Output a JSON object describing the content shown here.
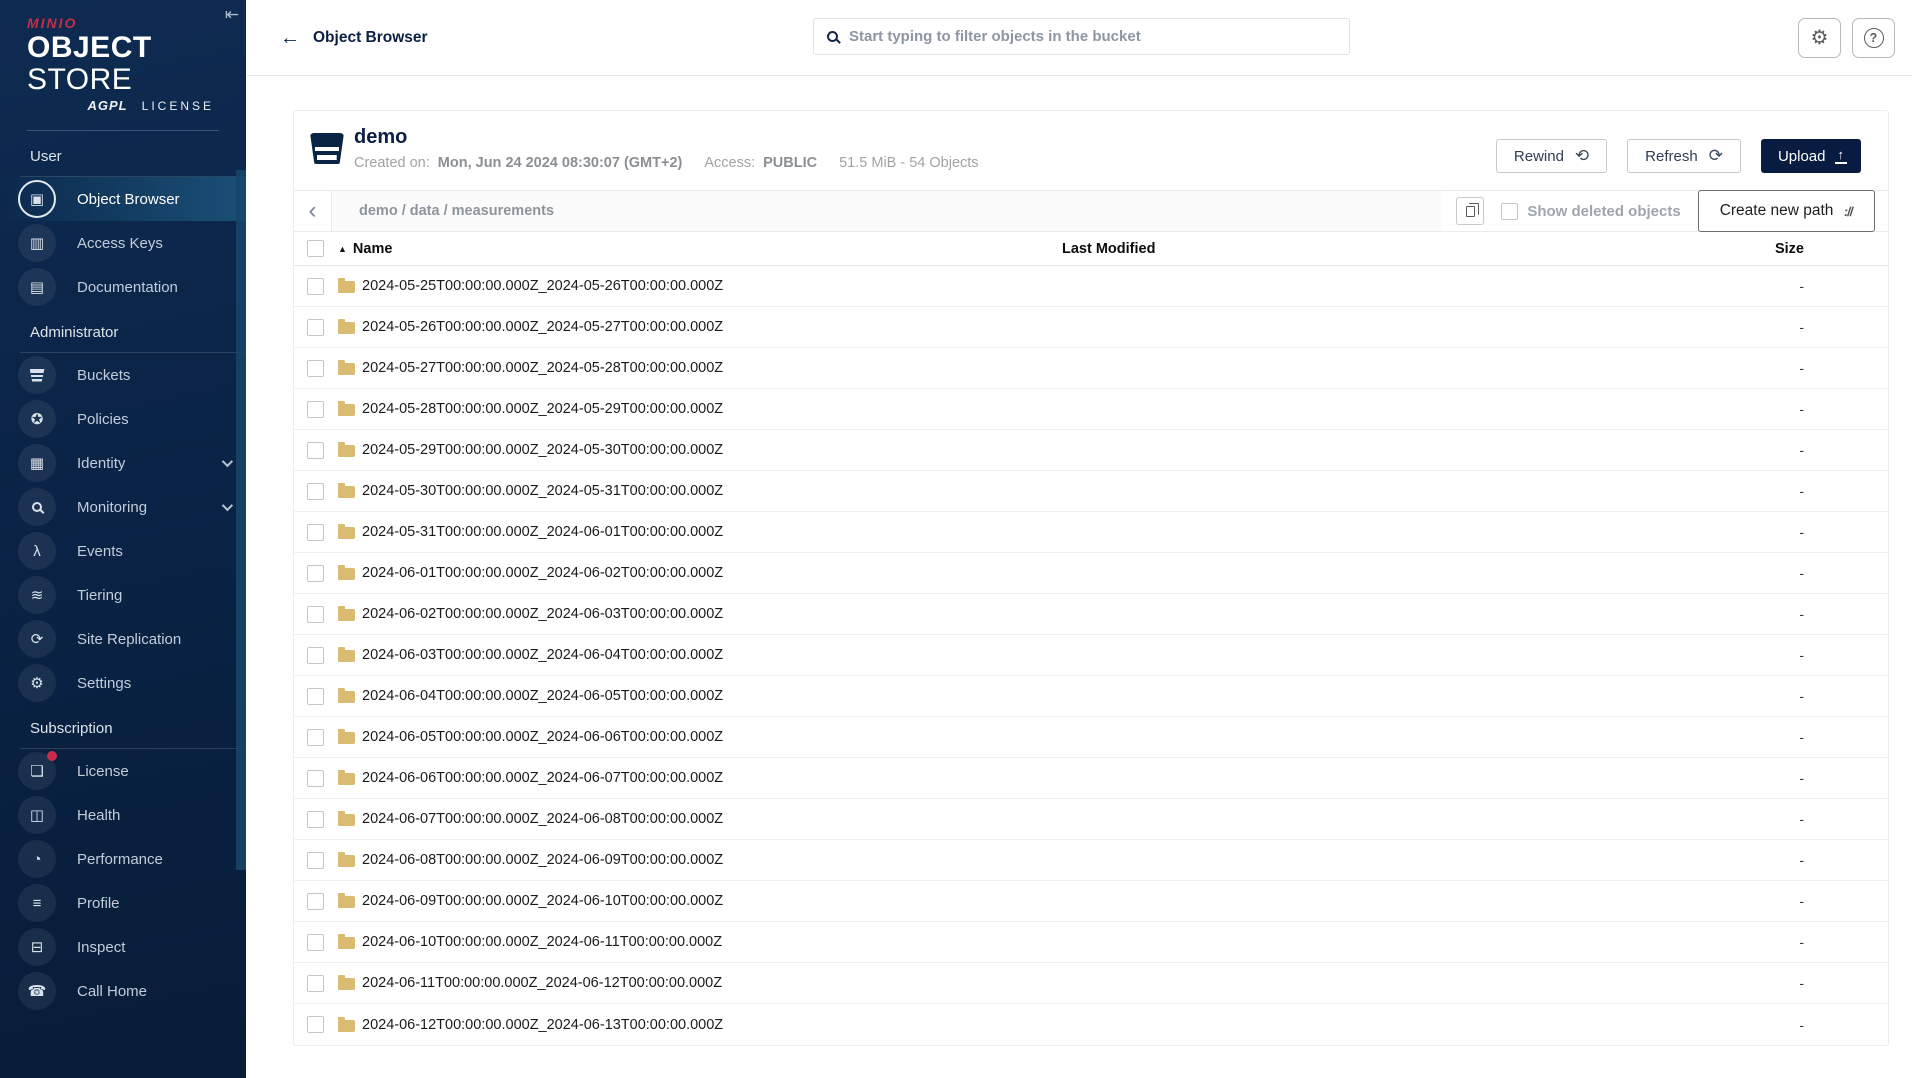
{
  "sidebar": {
    "logo": {
      "brand": "MINIO",
      "product_bold": "OBJECT",
      "product_light": "STORE",
      "license_badge": "AGPL",
      "license_label": "LICENSE"
    },
    "collapse_icon": "⇤",
    "sections": [
      {
        "label": "User",
        "items": [
          {
            "label": "Object Browser",
            "icon": "object-browser-icon",
            "glyph": "▣",
            "active": true
          },
          {
            "label": "Access Keys",
            "icon": "access-keys-icon",
            "glyph": "▥"
          },
          {
            "label": "Documentation",
            "icon": "documentation-icon",
            "glyph": "▤"
          }
        ]
      },
      {
        "label": "Administrator",
        "items": [
          {
            "label": "Buckets",
            "icon": "buckets-icon",
            "glyph": "css-bucket"
          },
          {
            "label": "Policies",
            "icon": "policies-icon",
            "glyph": "✪"
          },
          {
            "label": "Identity",
            "icon": "identity-icon",
            "glyph": "▦",
            "expandable": true
          },
          {
            "label": "Monitoring",
            "icon": "monitoring-icon",
            "glyph": "css-lens",
            "expandable": true
          },
          {
            "label": "Events",
            "icon": "events-icon",
            "glyph": "λ"
          },
          {
            "label": "Tiering",
            "icon": "tiering-icon",
            "glyph": "≋"
          },
          {
            "label": "Site Replication",
            "icon": "site-replication-icon",
            "glyph": "⟳"
          },
          {
            "label": "Settings",
            "icon": "settings-icon",
            "glyph": "⚙"
          }
        ]
      },
      {
        "label": "Subscription",
        "items": [
          {
            "label": "License",
            "icon": "license-icon",
            "glyph": "❏",
            "badge": true
          },
          {
            "label": "Health",
            "icon": "health-icon",
            "glyph": "◫"
          },
          {
            "label": "Performance",
            "icon": "performance-icon",
            "glyph": "◔"
          },
          {
            "label": "Profile",
            "icon": "profile-icon",
            "glyph": "≡"
          },
          {
            "label": "Inspect",
            "icon": "inspect-icon",
            "glyph": "⊟"
          },
          {
            "label": "Call Home",
            "icon": "call-home-icon",
            "glyph": "☎"
          }
        ]
      }
    ]
  },
  "topbar": {
    "back_icon": "←",
    "title": "Object Browser",
    "search_placeholder": "Start typing to filter objects in the bucket",
    "settings_icon": "⚙",
    "help_icon": "?"
  },
  "bucket": {
    "name": "demo",
    "created_label": "Created on:",
    "created_value": "Mon, Jun 24 2024 08:30:07 (GMT+2)",
    "access_label": "Access:",
    "access_value": "PUBLIC",
    "usage": "51.5 MiB - 54 Objects",
    "rewind_label": "Rewind",
    "rewind_icon": "⟲",
    "refresh_label": "Refresh",
    "refresh_icon": "⟳",
    "upload_label": "Upload",
    "upload_icon": "↑"
  },
  "browser": {
    "back_chevron": "‹",
    "path": "demo / data / measurements",
    "show_deleted_label": "Show deleted objects",
    "create_path_label": "Create new path",
    "create_path_icon": "://"
  },
  "table": {
    "sort_icon": "▲",
    "headers": {
      "name": "Name",
      "last_modified": "Last Modified",
      "size": "Size"
    },
    "rows": [
      {
        "name": "2024-05-25T00:00:00.000Z_2024-05-26T00:00:00.000Z",
        "last_modified": "",
        "size": "-"
      },
      {
        "name": "2024-05-26T00:00:00.000Z_2024-05-27T00:00:00.000Z",
        "last_modified": "",
        "size": "-"
      },
      {
        "name": "2024-05-27T00:00:00.000Z_2024-05-28T00:00:00.000Z",
        "last_modified": "",
        "size": "-"
      },
      {
        "name": "2024-05-28T00:00:00.000Z_2024-05-29T00:00:00.000Z",
        "last_modified": "",
        "size": "-"
      },
      {
        "name": "2024-05-29T00:00:00.000Z_2024-05-30T00:00:00.000Z",
        "last_modified": "",
        "size": "-"
      },
      {
        "name": "2024-05-30T00:00:00.000Z_2024-05-31T00:00:00.000Z",
        "last_modified": "",
        "size": "-"
      },
      {
        "name": "2024-05-31T00:00:00.000Z_2024-06-01T00:00:00.000Z",
        "last_modified": "",
        "size": "-"
      },
      {
        "name": "2024-06-01T00:00:00.000Z_2024-06-02T00:00:00.000Z",
        "last_modified": "",
        "size": "-"
      },
      {
        "name": "2024-06-02T00:00:00.000Z_2024-06-03T00:00:00.000Z",
        "last_modified": "",
        "size": "-"
      },
      {
        "name": "2024-06-03T00:00:00.000Z_2024-06-04T00:00:00.000Z",
        "last_modified": "",
        "size": "-"
      },
      {
        "name": "2024-06-04T00:00:00.000Z_2024-06-05T00:00:00.000Z",
        "last_modified": "",
        "size": "-"
      },
      {
        "name": "2024-06-05T00:00:00.000Z_2024-06-06T00:00:00.000Z",
        "last_modified": "",
        "size": "-"
      },
      {
        "name": "2024-06-06T00:00:00.000Z_2024-06-07T00:00:00.000Z",
        "last_modified": "",
        "size": "-"
      },
      {
        "name": "2024-06-07T00:00:00.000Z_2024-06-08T00:00:00.000Z",
        "last_modified": "",
        "size": "-"
      },
      {
        "name": "2024-06-08T00:00:00.000Z_2024-06-09T00:00:00.000Z",
        "last_modified": "",
        "size": "-"
      },
      {
        "name": "2024-06-09T00:00:00.000Z_2024-06-10T00:00:00.000Z",
        "last_modified": "",
        "size": "-"
      },
      {
        "name": "2024-06-10T00:00:00.000Z_2024-06-11T00:00:00.000Z",
        "last_modified": "",
        "size": "-"
      },
      {
        "name": "2024-06-11T00:00:00.000Z_2024-06-12T00:00:00.000Z",
        "last_modified": "",
        "size": "-"
      },
      {
        "name": "2024-06-12T00:00:00.000Z_2024-06-13T00:00:00.000Z",
        "last_modified": "",
        "size": "-"
      }
    ]
  },
  "colors": {
    "brand_red": "#C72C48",
    "navy": "#081C42",
    "folder": "#D9BC72",
    "active_item": "#1A5077"
  }
}
